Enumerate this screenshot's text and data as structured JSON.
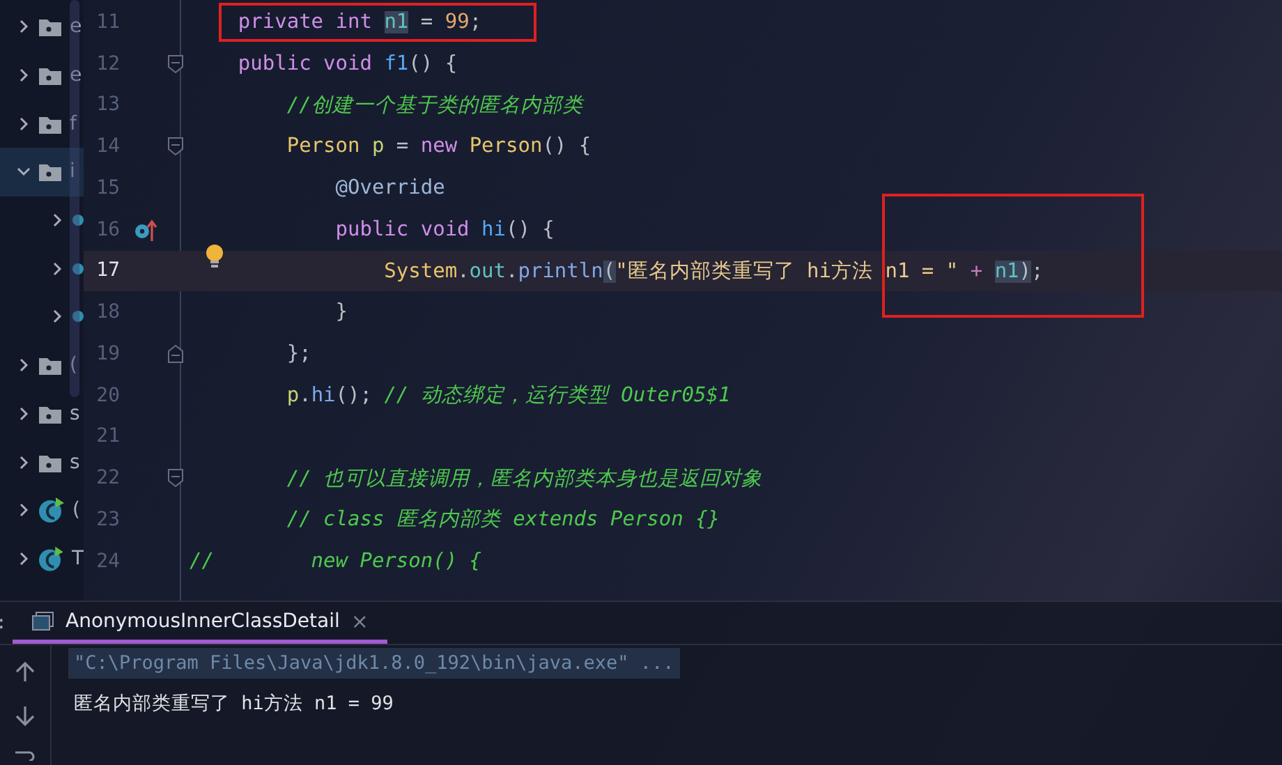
{
  "project_tree": {
    "items": [
      {
        "kind": "folder",
        "label": "e",
        "expanded": false,
        "selected": false
      },
      {
        "kind": "folder",
        "label": "e",
        "expanded": false,
        "selected": false
      },
      {
        "kind": "folder",
        "label": "f",
        "expanded": false,
        "selected": false
      },
      {
        "kind": "folder",
        "label": "i",
        "expanded": true,
        "selected": true,
        "children": [
          {
            "kind": "class",
            "expanded": false,
            "selected": false
          },
          {
            "kind": "class",
            "expanded": false,
            "selected": false
          },
          {
            "kind": "class",
            "expanded": false,
            "selected": false
          }
        ]
      },
      {
        "kind": "folder",
        "label": "(",
        "expanded": false,
        "selected": false
      },
      {
        "kind": "folder",
        "label": "s",
        "expanded": false,
        "selected": false
      },
      {
        "kind": "folder",
        "label": "s",
        "expanded": false,
        "selected": false
      },
      {
        "kind": "runnable",
        "label": "(",
        "expanded": false,
        "selected": false
      },
      {
        "kind": "runnable",
        "label": "T",
        "expanded": false,
        "selected": false
      }
    ]
  },
  "editor": {
    "lines": [
      {
        "number": "11",
        "current": false,
        "tokens": [
          {
            "kind": "keyword",
            "text": "    private int ",
            "highlighted": false
          },
          {
            "kind": "field",
            "text": "n1",
            "highlighted": true
          },
          {
            "kind": "plain",
            "text": " = ",
            "highlighted": false
          },
          {
            "kind": "number",
            "text": "99",
            "highlighted": false
          },
          {
            "kind": "plain",
            "text": ";",
            "highlighted": false
          }
        ]
      },
      {
        "number": "12",
        "current": false,
        "gutter": [
          {
            "kind": "fold_start"
          }
        ],
        "tokens": [
          {
            "kind": "keyword",
            "text": "    public void ",
            "highlighted": false
          },
          {
            "kind": "method",
            "text": "f1",
            "highlighted": false
          },
          {
            "kind": "plain",
            "text": "() {",
            "highlighted": false
          }
        ]
      },
      {
        "number": "13",
        "current": false,
        "tokens": [
          {
            "kind": "comment",
            "text": "        //创建一个基于类的匿名内部类",
            "highlighted": false
          }
        ]
      },
      {
        "number": "14",
        "current": false,
        "gutter": [
          {
            "kind": "fold_start"
          }
        ],
        "tokens": [
          {
            "kind": "type",
            "text": "        Person ",
            "highlighted": false
          },
          {
            "kind": "local",
            "text": "p",
            "highlighted": false
          },
          {
            "kind": "plain",
            "text": " = ",
            "highlighted": false
          },
          {
            "kind": "keyword",
            "text": "new ",
            "highlighted": false
          },
          {
            "kind": "type",
            "text": "Person",
            "highlighted": false
          },
          {
            "kind": "plain",
            "text": "() {",
            "highlighted": false
          }
        ]
      },
      {
        "number": "15",
        "current": false,
        "tokens": [
          {
            "kind": "annotation",
            "text": "            @Override",
            "highlighted": false
          }
        ]
      },
      {
        "number": "16",
        "current": false,
        "gutter": [
          {
            "kind": "override"
          }
        ],
        "tokens": [
          {
            "kind": "keyword",
            "text": "            public void ",
            "highlighted": false
          },
          {
            "kind": "method",
            "text": "hi",
            "highlighted": false
          },
          {
            "kind": "plain",
            "text": "() {",
            "highlighted": false
          }
        ]
      },
      {
        "number": "17",
        "current": true,
        "gutter": [
          {
            "kind": "bulb"
          }
        ],
        "tokens": [
          {
            "kind": "type",
            "text": "                System",
            "highlighted": false
          },
          {
            "kind": "plain",
            "text": ".",
            "highlighted": false
          },
          {
            "kind": "static",
            "text": "out",
            "highlighted": false
          },
          {
            "kind": "plain",
            "text": ".",
            "highlighted": false
          },
          {
            "kind": "call",
            "text": "println",
            "highlighted": false
          },
          {
            "kind": "plain",
            "text": "(",
            "highlighted": true
          },
          {
            "kind": "string",
            "text": "\"匿名内部类重写了 hi方法 n1 = \"",
            "highlighted": false
          },
          {
            "kind": "operator",
            "text": " + ",
            "highlighted": false
          },
          {
            "kind": "field",
            "text": "n1",
            "highlighted": true
          },
          {
            "kind": "plain",
            "text": ")",
            "highlighted": true
          },
          {
            "kind": "plain",
            "text": ";",
            "highlighted": false
          }
        ]
      },
      {
        "number": "18",
        "current": false,
        "tokens": [
          {
            "kind": "plain",
            "text": "            }",
            "highlighted": false
          }
        ]
      },
      {
        "number": "19",
        "current": false,
        "gutter": [
          {
            "kind": "fold_end"
          }
        ],
        "tokens": [
          {
            "kind": "plain",
            "text": "        };",
            "highlighted": false
          }
        ]
      },
      {
        "number": "20",
        "current": false,
        "tokens": [
          {
            "kind": "local",
            "text": "        p",
            "highlighted": false
          },
          {
            "kind": "plain",
            "text": ".",
            "highlighted": false
          },
          {
            "kind": "call",
            "text": "hi",
            "highlighted": false
          },
          {
            "kind": "plain",
            "text": "(); ",
            "highlighted": false
          },
          {
            "kind": "comment",
            "text": "// 动态绑定，运行类型 Outer05$1",
            "highlighted": false
          }
        ]
      },
      {
        "number": "21",
        "current": false
      },
      {
        "number": "22",
        "current": false,
        "gutter": [
          {
            "kind": "fold_start"
          }
        ],
        "tokens": [
          {
            "kind": "comment",
            "text": "        // 也可以直接调用，匿名内部类本身也是返回对象",
            "highlighted": false
          }
        ]
      },
      {
        "number": "23",
        "current": false,
        "tokens": [
          {
            "kind": "comment",
            "text": "        // class 匿名内部类 extends Person {}",
            "highlighted": false
          }
        ]
      },
      {
        "number": "24",
        "current": false,
        "tokens": [
          {
            "kind": "comment",
            "text": "//        new Person() {",
            "highlighted": false
          }
        ]
      }
    ]
  },
  "run_panel": {
    "label": ":",
    "tabs": [
      {
        "title": "AnonymousInnerClassDetail",
        "close": "×",
        "selected": true
      }
    ],
    "console": [
      {
        "kind": "command",
        "text": "\"C:\\Program Files\\Java\\jdk1.8.0_192\\bin\\java.exe\" ..."
      },
      {
        "kind": "output",
        "text": "匿名内部类重写了 hi方法 n1 = 99"
      }
    ]
  }
}
